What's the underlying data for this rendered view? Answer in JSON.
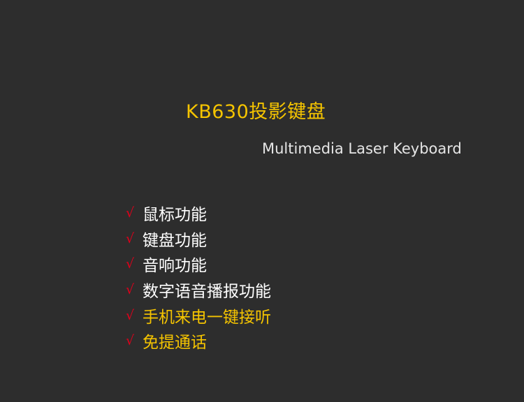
{
  "title": "KB630投影键盘",
  "subtitle": "Multimedia Laser Keyboard",
  "check_mark": "√",
  "features": [
    {
      "label": "鼠标功能"
    },
    {
      "label": "键盘功能"
    },
    {
      "label": "音响功能"
    },
    {
      "label": "数字语音播报功能"
    },
    {
      "label": "手机来电一键接听"
    },
    {
      "label": "免提通话"
    }
  ],
  "colors": {
    "background": "#2d2d2d",
    "title": "#f5c400",
    "check": "#e0001b",
    "text": "#ffffff",
    "highlight": "#f5c400"
  }
}
